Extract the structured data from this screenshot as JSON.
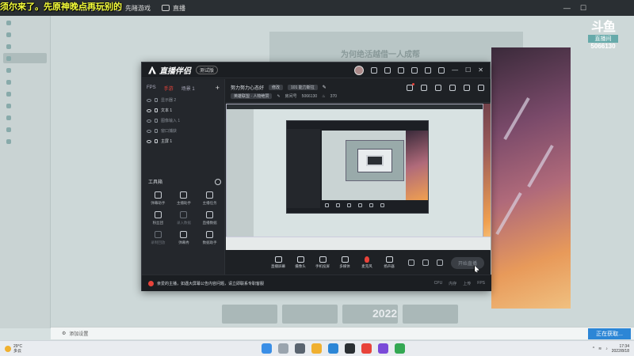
{
  "overlay": {
    "text": "须尔来了。先原神晚点再玩别的"
  },
  "watermark": {
    "logo": "斗鱼",
    "sub": "直播间",
    "room_id": "5066130"
  },
  "background_app": {
    "top_tabs": [
      {
        "label": "首页"
      },
      {
        "label": "先睹游戏"
      },
      {
        "label": "直播"
      }
    ],
    "banner_text": "为何绝活越借一人成帮",
    "thumb_text": "2022",
    "bottom_left": "添加设置",
    "bottom_right": "正在获取...",
    "start_label": "开始直播"
  },
  "window": {
    "app_name": "直播伴侣",
    "version": "测试版",
    "scene_tabs": [
      {
        "label": "FPS"
      },
      {
        "label": "手游"
      },
      {
        "label": "场景 1"
      }
    ],
    "sources": [
      {
        "label": "显示器 2",
        "bright": false
      },
      {
        "label": "文本 1",
        "bright": true
      },
      {
        "label": "图像输入 1",
        "bright": false
      },
      {
        "label": "窗口捕获",
        "bright": false
      },
      {
        "label": "主屏 1",
        "bright": true
      }
    ],
    "tools_title": "工具箱",
    "tools": [
      {
        "label": "弹幕助手",
        "dim": false
      },
      {
        "label": "主播助手",
        "dim": false
      },
      {
        "label": "主播任务",
        "dim": false
      },
      {
        "label": "粉丝团",
        "dim": false
      },
      {
        "label": "录入数据",
        "dim": true
      },
      {
        "label": "直播数据",
        "dim": false
      },
      {
        "label": "录制回放",
        "dim": true
      },
      {
        "label": "弹幕秀",
        "dim": false
      },
      {
        "label": "数据助手",
        "dim": false
      }
    ],
    "room_title": "努力努力心态好",
    "room_chip": "修改",
    "room_tag": "101 能力斯拉",
    "room_category": "英雄联盟 · 人物绝赞",
    "room_label": "房间号",
    "room_number": "5066130",
    "room_viewers": "370",
    "controls": [
      {
        "label": "直播屏幕",
        "icon": "screen-share-icon"
      },
      {
        "label": "摄像头",
        "icon": "camera-icon"
      },
      {
        "label": "手机投屏",
        "icon": "phone-icon"
      },
      {
        "label": "多媒体",
        "icon": "media-icon"
      },
      {
        "label": "麦克风",
        "icon": "mic-icon"
      },
      {
        "label": "扬声器",
        "icon": "speaker-icon"
      }
    ],
    "go_live_label": "开始直播",
    "status_text": "亲爱的主播，如遇大屏幕公告内容问题，请立即联系专职客服",
    "status_right": [
      "CPU",
      "内存",
      "上传",
      "FPS"
    ]
  },
  "taskbar": {
    "weather_temp": "29°C",
    "weather_desc": "多云",
    "time": "17:34",
    "date": "2022/8/18"
  },
  "colors": {
    "accent_red": "#e8433a",
    "window_bg": "#1e2125",
    "start_blue": "#2c86d6"
  }
}
